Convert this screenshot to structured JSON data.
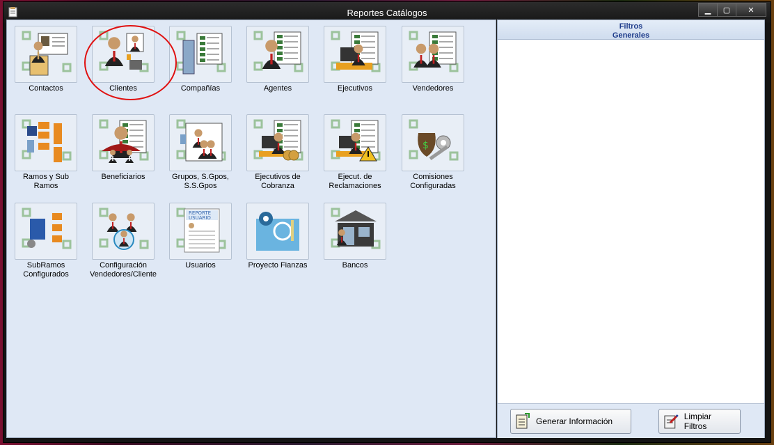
{
  "window": {
    "title": "Reportes Catálogos"
  },
  "controls": {
    "minimize": "▁",
    "maximize": "▢",
    "close": "✕"
  },
  "filters": {
    "header": "Filtros\nGenerales"
  },
  "buttons": {
    "generate": "Generar Información",
    "clear": "Limpiar Filtros"
  },
  "catalog": [
    {
      "label": "Contactos",
      "icon": "contact-card-icon"
    },
    {
      "label": "Clientes",
      "icon": "clients-icon"
    },
    {
      "label": "Compañías",
      "icon": "companies-icon"
    },
    {
      "label": "Agentes",
      "icon": "agents-icon"
    },
    {
      "label": "Ejecutivos",
      "icon": "executives-icon"
    },
    {
      "label": "Vendedores",
      "icon": "sellers-icon"
    },
    {
      "label": "Ramos y Sub\nRamos",
      "icon": "branches-icon"
    },
    {
      "label": "Beneficiarios",
      "icon": "beneficiaries-icon"
    },
    {
      "label": "Grupos, S.Gpos,\nS.S.Gpos",
      "icon": "groups-icon"
    },
    {
      "label": "Ejecutivos de\nCobranza",
      "icon": "collection-executives-icon"
    },
    {
      "label": "Ejecut. de\nReclamaciones",
      "icon": "claims-executives-icon"
    },
    {
      "label": "Comisiones\nConfiguradas",
      "icon": "commissions-icon"
    },
    {
      "label": "SubRamos\nConfigurados",
      "icon": "subbranches-icon"
    },
    {
      "label": "Configuración\nVendedores/Cliente",
      "icon": "seller-config-icon"
    },
    {
      "label": "Usuarios",
      "icon": "users-report-icon"
    },
    {
      "label": "Proyecto Fianzas",
      "icon": "bonds-project-icon"
    },
    {
      "label": "Bancos",
      "icon": "banks-icon"
    }
  ],
  "report_icon_text": "REPORTE\nUSUARIO",
  "colors": {
    "panel_bg": "#dfe8f5",
    "header_text": "#1d3b8a",
    "annotation": "#e01010"
  }
}
